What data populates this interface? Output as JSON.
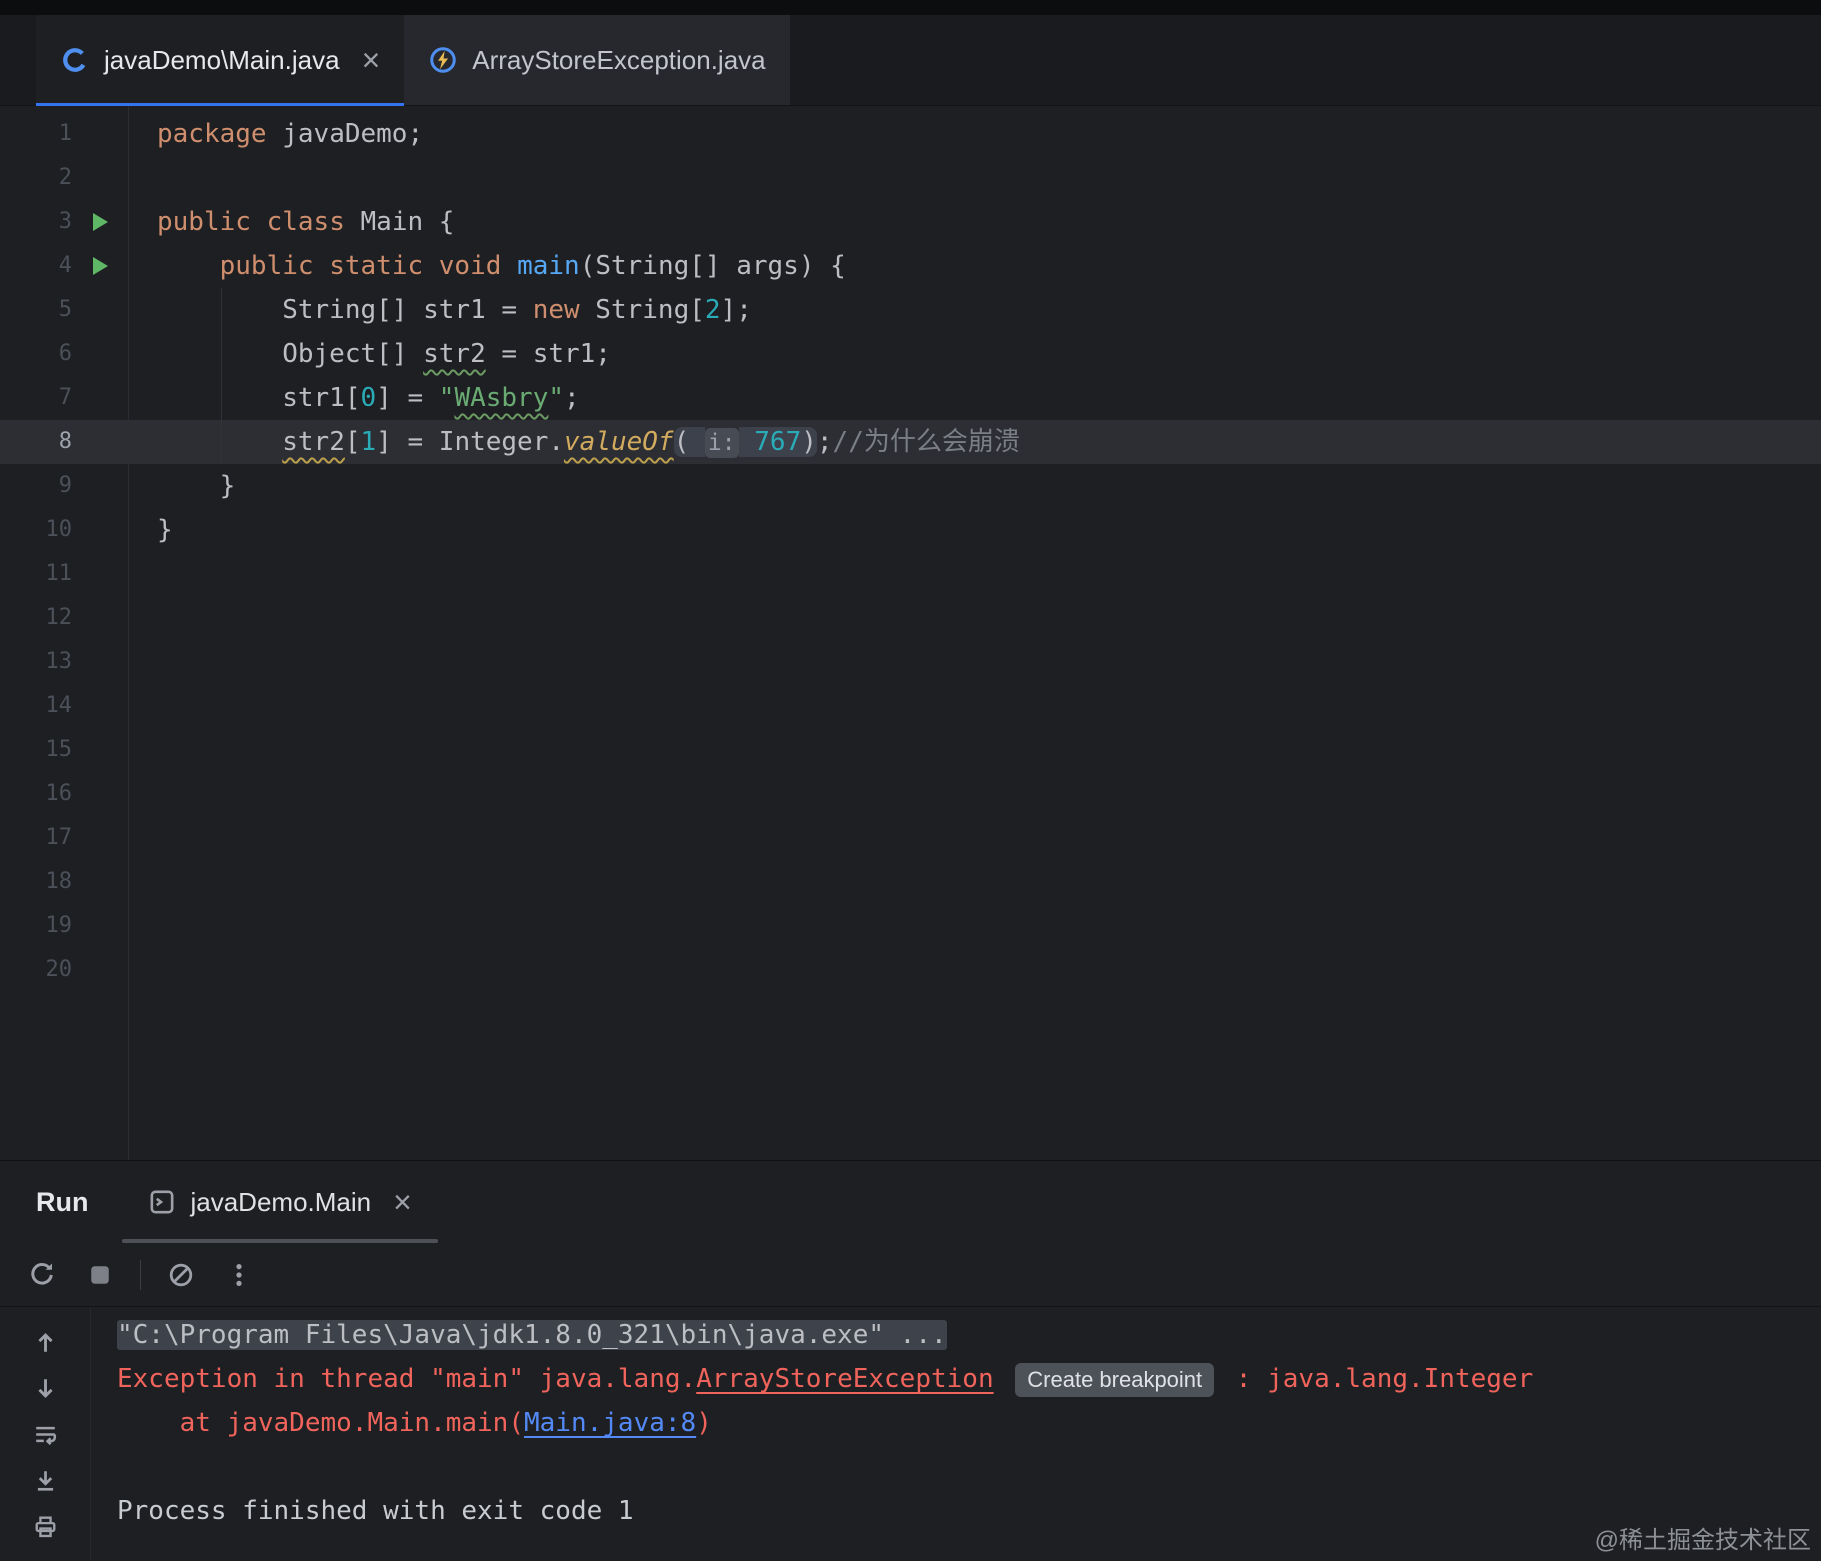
{
  "icons": {
    "close": "×"
  },
  "editor_tabs": [
    {
      "label": "javaDemo\\Main.java",
      "icon": "java-class-icon",
      "active": true,
      "closable": true
    },
    {
      "label": "ArrayStoreException.java",
      "icon": "java-exception-class-icon",
      "active": false
    }
  ],
  "editor": {
    "caret_line": 8,
    "run_lines": [
      3,
      4
    ],
    "lines": [
      {
        "n": 1,
        "tokens": [
          {
            "t": "package",
            "c": "kw"
          },
          {
            "t": " javaDemo;",
            "c": "pl"
          }
        ]
      },
      {
        "n": 2,
        "tokens": []
      },
      {
        "n": 3,
        "tokens": [
          {
            "t": "public",
            "c": "kw"
          },
          {
            "t": " ",
            "c": "pl"
          },
          {
            "t": "class",
            "c": "kw"
          },
          {
            "t": " Main {",
            "c": "pl"
          }
        ]
      },
      {
        "n": 4,
        "tokens": [
          {
            "t": "    ",
            "c": "pl"
          },
          {
            "t": "public",
            "c": "kw"
          },
          {
            "t": " ",
            "c": "pl"
          },
          {
            "t": "static",
            "c": "kw"
          },
          {
            "t": " ",
            "c": "pl"
          },
          {
            "t": "void",
            "c": "kw"
          },
          {
            "t": " ",
            "c": "pl"
          },
          {
            "t": "main",
            "c": "fn"
          },
          {
            "t": "(String[] args) {",
            "c": "pl"
          }
        ]
      },
      {
        "n": 5,
        "tokens": [
          {
            "t": "        String[] str1 = ",
            "c": "pl"
          },
          {
            "t": "new",
            "c": "kw"
          },
          {
            "t": " String[",
            "c": "pl"
          },
          {
            "t": "2",
            "c": "num"
          },
          {
            "t": "];",
            "c": "pl"
          }
        ]
      },
      {
        "n": 6,
        "tokens": [
          {
            "t": "        Object[] ",
            "c": "pl"
          },
          {
            "t": "str2",
            "c": "pl typo"
          },
          {
            "t": " = str1;",
            "c": "pl"
          }
        ]
      },
      {
        "n": 7,
        "tokens": [
          {
            "t": "        str1[",
            "c": "pl"
          },
          {
            "t": "0",
            "c": "num"
          },
          {
            "t": "] = ",
            "c": "pl"
          },
          {
            "t": "\"",
            "c": "str"
          },
          {
            "t": "WAsbry",
            "c": "str typo"
          },
          {
            "t": "\"",
            "c": "str"
          },
          {
            "t": ";",
            "c": "pl"
          }
        ]
      },
      {
        "n": 8,
        "tokens": [
          {
            "t": "        ",
            "c": "pl"
          },
          {
            "t": "str2",
            "c": "pl warn"
          },
          {
            "t": "[",
            "c": "pl"
          },
          {
            "t": "1",
            "c": "num"
          },
          {
            "t": "] = Integer.",
            "c": "pl"
          },
          {
            "t": "valueOf",
            "c": "msi warn"
          },
          {
            "t": "( ",
            "c": "pl phl phl-l"
          },
          {
            "t": "i:",
            "c": "inlay"
          },
          {
            "t": " ",
            "c": "phl"
          },
          {
            "t": "767",
            "c": "num phl"
          },
          {
            "t": ")",
            "c": "pl phl phl-r"
          },
          {
            "t": ";",
            "c": "pl"
          },
          {
            "t": "//为什么会崩溃",
            "c": "cmt"
          }
        ]
      },
      {
        "n": 9,
        "tokens": [
          {
            "t": "    }",
            "c": "pl"
          }
        ]
      },
      {
        "n": 10,
        "tokens": [
          {
            "t": "}",
            "c": "pl"
          }
        ]
      },
      {
        "n": 11,
        "tokens": []
      },
      {
        "n": 12,
        "tokens": []
      },
      {
        "n": 13,
        "tokens": []
      },
      {
        "n": 14,
        "tokens": []
      },
      {
        "n": 15,
        "tokens": []
      },
      {
        "n": 16,
        "tokens": []
      },
      {
        "n": 17,
        "tokens": []
      },
      {
        "n": 18,
        "tokens": []
      },
      {
        "n": 19,
        "tokens": []
      },
      {
        "n": 20,
        "tokens": []
      }
    ]
  },
  "run_panel": {
    "title": "Run",
    "tab_label": "javaDemo.Main",
    "toolbar_icons": [
      "rerun-icon",
      "stop-icon",
      "clear-output-icon",
      "more-options-icon"
    ],
    "console_toolbar_icons": [
      "scroll-up-icon",
      "scroll-down-icon",
      "soft-wrap-icon",
      "scroll-to-end-icon",
      "print-icon"
    ],
    "console": [
      {
        "segments": [
          {
            "t": "\"C:\\Program Files\\Java\\jdk1.8.0_321\\bin\\java.exe\" ...",
            "c": "sel",
            "name": "java-command-line"
          }
        ]
      },
      {
        "segments": [
          {
            "t": "Exception in thread \"main\" java.lang.",
            "c": "err"
          },
          {
            "t": "ArrayStoreException",
            "c": "err elink",
            "name": "exception-class-link"
          },
          {
            "t": " ",
            "c": "err"
          },
          {
            "t": "Create breakpoint",
            "c": "chip",
            "name": "create-breakpoint-button"
          },
          {
            "t": " : java.lang.Integer",
            "c": "err"
          }
        ]
      },
      {
        "segments": [
          {
            "t": "    at javaDemo.Main.main(",
            "c": "err"
          },
          {
            "t": "Main.java:8",
            "c": "link",
            "name": "stack-frame-link"
          },
          {
            "t": ")",
            "c": "err"
          }
        ]
      },
      {
        "segments": []
      },
      {
        "segments": [
          {
            "t": "Process finished with exit code 1",
            "c": "out",
            "name": "process-exit-message"
          }
        ]
      }
    ]
  },
  "watermark": "@稀土掘金技术社区"
}
